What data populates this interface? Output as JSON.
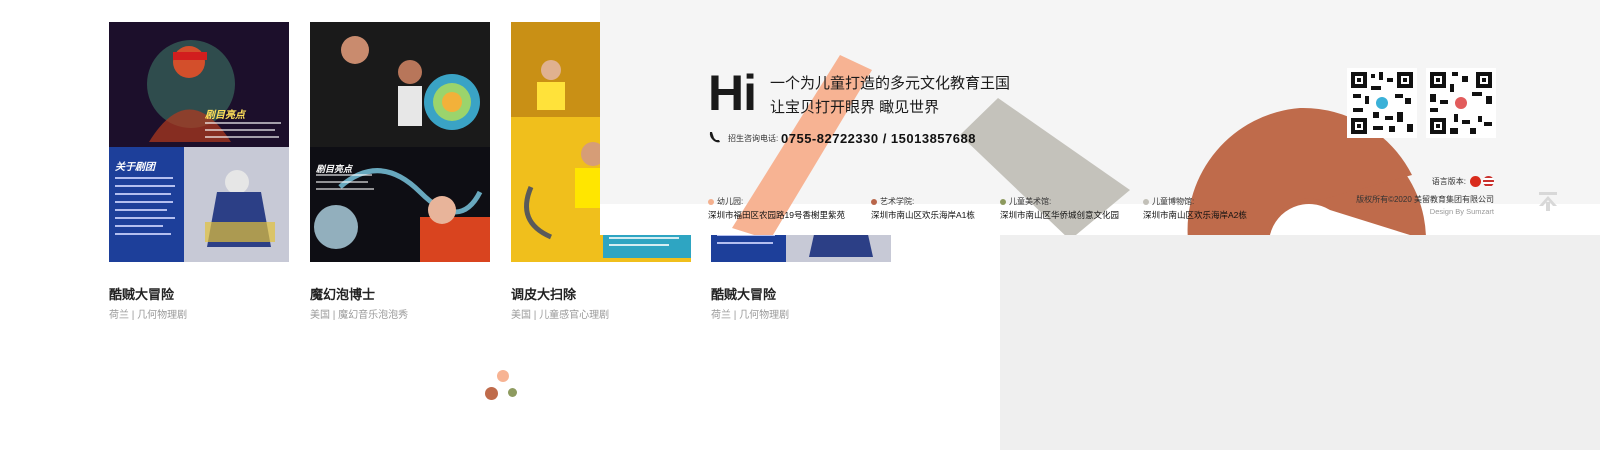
{
  "cards": [
    {
      "title": "酷贼大冒险",
      "subtitle": "荷兰 | 几何物理剧",
      "poster_heading": "关于剧团",
      "poster_badge": "剧目亮点"
    },
    {
      "title": "魔幻泡博士",
      "subtitle": "美国 | 魔幻音乐泡泡秀",
      "poster_heading": "剧目亮点"
    },
    {
      "title": "调皮大扫除",
      "subtitle": "美国 | 儿童感官心理剧"
    },
    {
      "title": "酷贼大冒险",
      "subtitle": "荷兰 | 几何物理剧"
    }
  ],
  "footer": {
    "hi": "Hi",
    "slogan_line1": "一个为儿童打造的多元文化教育王国",
    "slogan_line2": "让宝贝打开眼界 瞰见世界",
    "phone_label": "招生咨询电话:",
    "phone_numbers": "0755-82722330 / 15013857688",
    "addresses": [
      {
        "label": "幼儿园:",
        "text": "深圳市福田区农园路19号香榭里紫苑",
        "color": "#f4b08e"
      },
      {
        "label": "艺术学院:",
        "text": "深圳市南山区欢乐海岸A1栋",
        "color": "#b9664a"
      },
      {
        "label": "儿童美术馆:",
        "text": "深圳市南山区华侨城创意文化园",
        "color": "#8d9a5e"
      },
      {
        "label": "儿童博物馆:",
        "text": "深圳市南山区欢乐海岸A2栋",
        "color": "#c2c0b8"
      }
    ],
    "language_label": "语言版本:",
    "copyright": "版权所有©2020 美留教育集团有限公司",
    "design_by": "Design By Sumzart",
    "colors": {
      "peach": "#f7b393",
      "rust": "#bf6b4b",
      "grey": "#c4c2bb",
      "olive": "#8e9b60"
    }
  },
  "icons": [
    "phone-icon",
    "qr-code-icon",
    "flag-cn-icon",
    "flag-us-icon",
    "back-to-top-icon"
  ]
}
